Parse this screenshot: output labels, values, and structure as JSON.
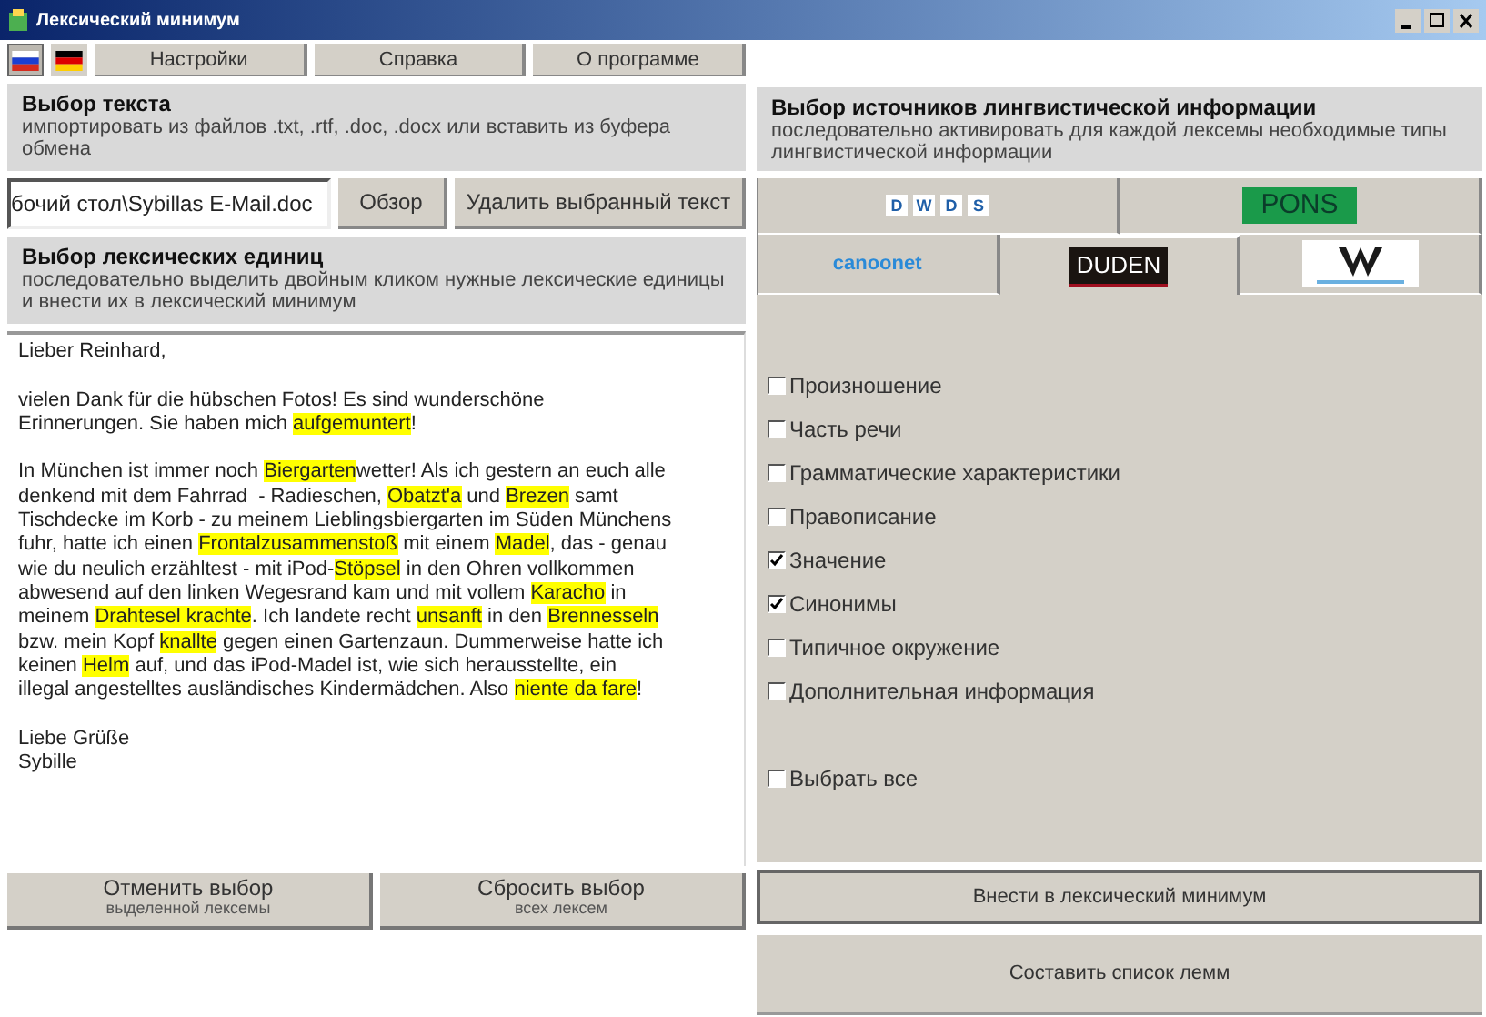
{
  "window": {
    "title": "Лексический минимум"
  },
  "languages": [
    {
      "kind": "ru",
      "selected": true
    },
    {
      "kind": "de",
      "selected": false
    }
  ],
  "menu": [
    "Настройки",
    "Справка",
    "О программе"
  ],
  "text_section": {
    "title": "Выбор текста",
    "hint": "импортировать из файлов .txt, .rtf, .doc, .docx или вставить из буфера обмена"
  },
  "file_path": "бочий стол\\Sybillas E-Mail.doc",
  "file_buttons": [
    "Обзор",
    "Удалить выбранный текст"
  ],
  "units_section": {
    "title": "Выбор лексических единиц",
    "hint": "последовательно выделить двойным кликом нужные лексические единицы и внести их в лексический минимум"
  },
  "letter": [
    [
      [
        {
          "text": "Lieber Reinhard,",
          "highlighted": false
        }
      ]
    ],
    [
      [
        {
          "text": "vielen Dank für die hübschen Fotos! Es sind wunderschöne",
          "highlighted": false
        }
      ],
      [
        {
          "text": "Erinnerungen. Sie haben mich ",
          "highlighted": false
        },
        {
          "text": "aufgemuntert",
          "highlighted": true
        },
        {
          "text": "!",
          "highlighted": false
        }
      ]
    ],
    [
      [
        {
          "text": "In München ist immer noch ",
          "highlighted": false
        },
        {
          "text": "Biergarten",
          "highlighted": true
        },
        {
          "text": "wetter! Als ich gestern an euch alle",
          "highlighted": false
        }
      ],
      [
        {
          "text": "denkend mit dem Fahrrad  - Radieschen, ",
          "highlighted": false
        },
        {
          "text": "Obatzt'a",
          "highlighted": true
        },
        {
          "text": " und ",
          "highlighted": false
        },
        {
          "text": "Brezen",
          "highlighted": true
        },
        {
          "text": " samt",
          "highlighted": false
        }
      ],
      [
        {
          "text": "Tischdecke im Korb - zu meinem Lieblingsbiergarten im Süden Münchens",
          "highlighted": false
        }
      ],
      [
        {
          "text": "fuhr, hatte ich einen ",
          "highlighted": false
        },
        {
          "text": "Frontalzusammenstoß",
          "highlighted": true
        },
        {
          "text": " mit einem ",
          "highlighted": false
        },
        {
          "text": "Madel",
          "highlighted": true
        },
        {
          "text": ", das - genau",
          "highlighted": false
        }
      ],
      [
        {
          "text": "wie du neulich erzähltest - mit iPod-",
          "highlighted": false
        },
        {
          "text": "Stöpsel",
          "highlighted": true
        },
        {
          "text": " in den Ohren vollkommen",
          "highlighted": false
        }
      ],
      [
        {
          "text": "abwesend auf den linken Wegesrand kam und mit vollem ",
          "highlighted": false
        },
        {
          "text": "Karacho",
          "highlighted": true
        },
        {
          "text": " in",
          "highlighted": false
        }
      ],
      [
        {
          "text": "meinem ",
          "highlighted": false
        },
        {
          "text": "Drahtesel krachte",
          "highlighted": true
        },
        {
          "text": ". Ich landete recht ",
          "highlighted": false
        },
        {
          "text": "unsanft",
          "highlighted": true
        },
        {
          "text": " in den ",
          "highlighted": false
        },
        {
          "text": "Brennesseln",
          "highlighted": true
        }
      ],
      [
        {
          "text": "bzw. mein Kopf ",
          "highlighted": false
        },
        {
          "text": "knallte",
          "highlighted": true
        },
        {
          "text": " gegen einen Gartenzaun. Dummerweise hatte ich",
          "highlighted": false
        }
      ],
      [
        {
          "text": "keinen ",
          "highlighted": false
        },
        {
          "text": "Helm",
          "highlighted": true
        },
        {
          "text": " auf, und das iPod-Madel ist, wie sich herausstellte, ein",
          "highlighted": false
        }
      ],
      [
        {
          "text": "illegal angestelltes ausländisches Kindermädchen. Also ",
          "highlighted": false
        },
        {
          "text": "niente da fare",
          "highlighted": true
        },
        {
          "text": "!",
          "highlighted": false
        }
      ]
    ],
    [
      [
        {
          "text": "Liebe Grüße",
          "highlighted": false
        }
      ],
      [
        {
          "text": "Sybille",
          "highlighted": false
        }
      ]
    ]
  ],
  "selection_buttons": [
    {
      "label": "Отменить выбор",
      "sublabel": "выделенной лексемы"
    },
    {
      "label": "Сбросить выбор",
      "sublabel": "всех лексем"
    }
  ],
  "sources_section": {
    "title": "Выбор источников лингвистической информации",
    "hint": "последовательно активировать для каждой лексемы необходимые типы лингвистической информации"
  },
  "source_tabs": [
    [
      {
        "kind": "dwds",
        "letters": [
          "D",
          "W",
          "D",
          "S"
        ],
        "selected": false
      },
      {
        "kind": "pons",
        "label": "PONS",
        "selected": false
      }
    ],
    [
      {
        "kind": "canoonet",
        "label": "canoonet",
        "selected": false
      },
      {
        "kind": "duden",
        "label": "DUDEN",
        "selected": true
      },
      {
        "kind": "wortschatz",
        "selected": false
      }
    ]
  ],
  "info_types": [
    {
      "label": "Произношение",
      "checked": false
    },
    {
      "label": "Часть речи",
      "checked": false
    },
    {
      "label": "Грамматические характеристики",
      "checked": false
    },
    {
      "label": "Правописание",
      "checked": false
    },
    {
      "label": "Значение",
      "checked": true
    },
    {
      "label": "Синонимы",
      "checked": true
    },
    {
      "label": "Типичное окружение",
      "checked": false
    },
    {
      "label": "Дополнительная информация",
      "checked": false
    }
  ],
  "select_all": {
    "label": "Выбрать все",
    "checked": false
  },
  "actions": [
    "Внести в лексический минимум",
    "Составить список лемм"
  ]
}
